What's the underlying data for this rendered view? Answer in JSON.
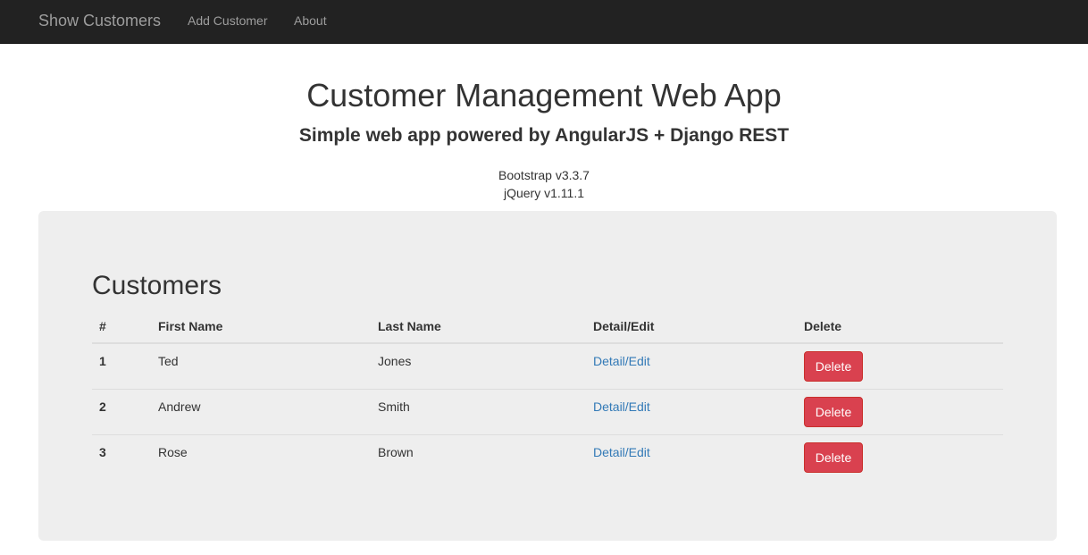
{
  "navbar": {
    "brand": "Show Customers",
    "links": [
      "Add Customer",
      "About"
    ]
  },
  "header": {
    "title": "Customer Management Web App",
    "subtitle": "Simple web app powered by AngularJS + Django REST",
    "versions": [
      "Bootstrap v3.3.7",
      "jQuery v1.11.1"
    ]
  },
  "customers": {
    "title": "Customers",
    "columns": [
      "#",
      "First Name",
      "Last Name",
      "Detail/Edit",
      "Delete"
    ],
    "rows": [
      {
        "id": "1",
        "first_name": "Ted",
        "last_name": "Jones",
        "link": "Detail/Edit",
        "delete_label": "Delete"
      },
      {
        "id": "2",
        "first_name": "Andrew",
        "last_name": "Smith",
        "link": "Detail/Edit",
        "delete_label": "Delete"
      },
      {
        "id": "3",
        "first_name": "Rose",
        "last_name": "Brown",
        "link": "Detail/Edit",
        "delete_label": "Delete"
      }
    ]
  },
  "colors": {
    "navbar_bg": "#222222",
    "panel_bg": "#eeeeee",
    "link": "#337ab7",
    "danger": "#d9414f"
  }
}
